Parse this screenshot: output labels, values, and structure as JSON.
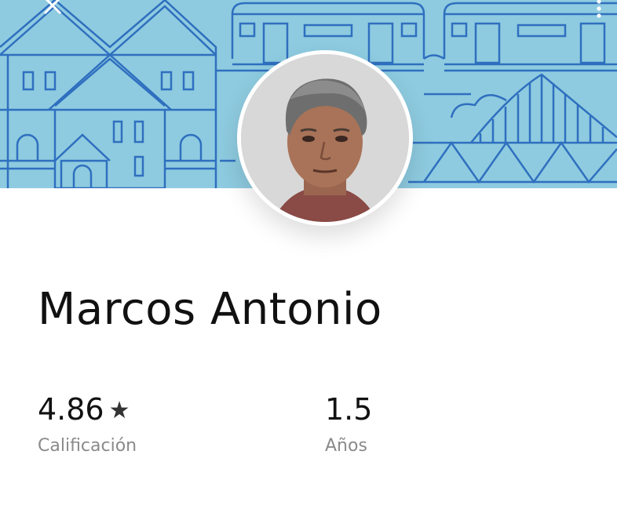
{
  "profile": {
    "name": "Marcos Antonio",
    "stats": {
      "rating": {
        "value": "4.86",
        "label": "Calificación"
      },
      "years": {
        "value": "1.5",
        "label": "Años"
      }
    }
  },
  "icons": {
    "close": "close-icon",
    "menu": "more-vertical-icon",
    "rating": "star-icon"
  },
  "colors": {
    "banner_background": "#8ecbe0",
    "banner_lines": "#2f6fbf",
    "text_primary": "#111111",
    "text_secondary": "#8a8a8a"
  }
}
